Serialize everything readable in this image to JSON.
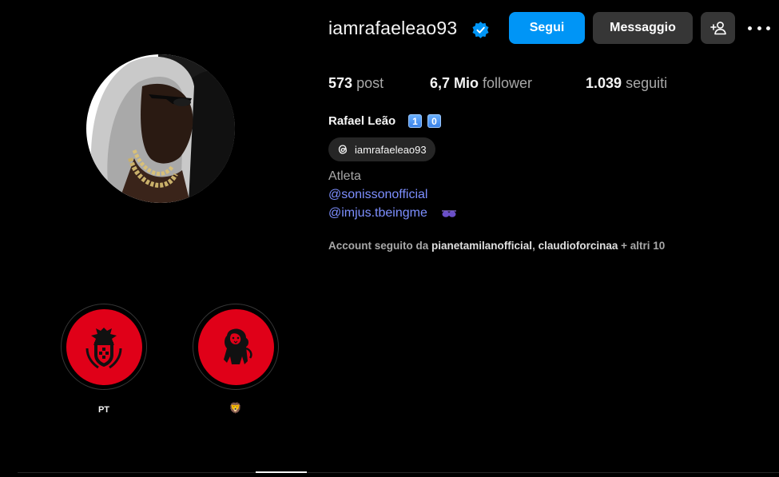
{
  "profile": {
    "username": "iamrafaeleao93",
    "full_name": "Rafael Leão",
    "name_emoji_1": "1",
    "name_emoji_2": "0",
    "threads_handle": "iamrafaeleao93",
    "category": "Atleta",
    "links": [
      "@sonissonofficial",
      "@imjus.tbeingme"
    ],
    "verified_color": "#0095f6"
  },
  "actions": {
    "follow_label": "Segui",
    "message_label": "Messaggio"
  },
  "stats": {
    "posts_value": "573",
    "posts_label": "post",
    "followers_value": "6,7 Mio",
    "followers_label": "follower",
    "following_value": "1.039",
    "following_label": "seguiti"
  },
  "followed_by": {
    "prefix": "Account seguito da",
    "account_1": "pianetamilanofficial",
    "separator": ",",
    "account_2": "claudioforcinaa",
    "suffix": "+ altri 10"
  },
  "highlights": [
    {
      "label": "PT",
      "icon": "portugal-crest-icon"
    },
    {
      "label": "🦁",
      "icon": "lion-icon"
    }
  ],
  "colors": {
    "background": "#000000",
    "accent": "#0095f6",
    "link": "#7d8fff",
    "highlight_red": "#e00018"
  }
}
